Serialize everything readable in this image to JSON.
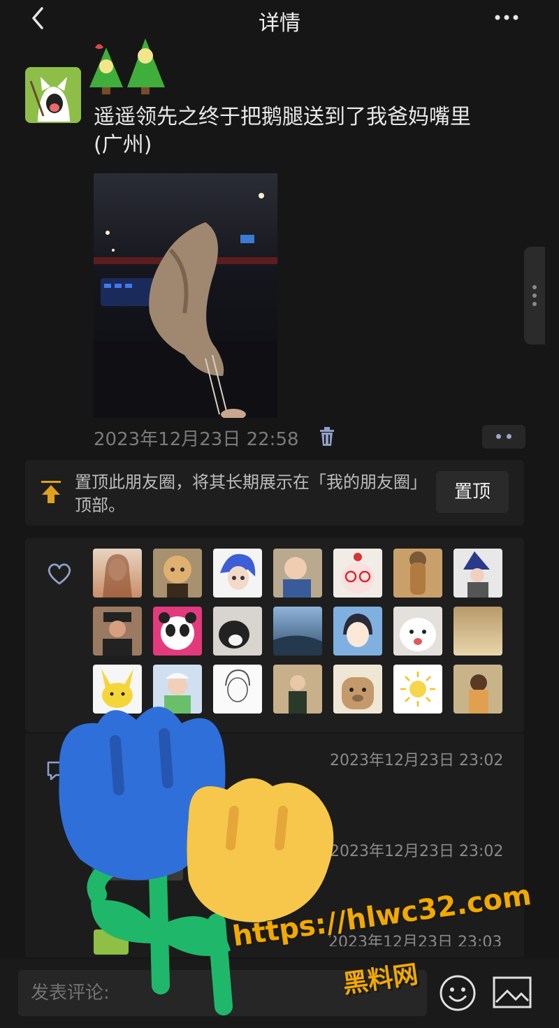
{
  "header": {
    "title": "详情"
  },
  "post": {
    "text": "遥遥领先之终于把鹅腿送到了我爸妈嘴里",
    "location": "(广州)",
    "time": "2023年12月23日 22:58"
  },
  "pin": {
    "description": "置顶此朋友圈，将其长期展示在「我的朋友圈」顶部。",
    "button_label": "置顶"
  },
  "likes": {
    "avatar_icons": [
      "woman-portrait",
      "cartoon-girl",
      "blue-anime-boy",
      "baby-photo",
      "cake-cartoon",
      "guitar-cat",
      "woman-hat",
      "man-hat",
      "panda-cartoon",
      "cat-photo",
      "seascape",
      "anime-girl",
      "white-dog",
      "gold-silk",
      "pikachu",
      "woman-flowers",
      "sketch-boy",
      "woman-portrait-2",
      "capybara",
      "sun-drawing",
      "illustration"
    ]
  },
  "comments": [
    {
      "time": "2023年12月23日 23:02"
    },
    {
      "time": "2023年12月23日 23:02"
    },
    {
      "time": "2023年12月23日 23:03"
    }
  ],
  "compose": {
    "placeholder": "发表评论:"
  },
  "watermark": {
    "url": "https://hlwc32.com",
    "name": "黑料网"
  },
  "colors": {
    "background": "#161616",
    "panel": "#1e1e1e",
    "watermark": "#f2a900",
    "tulip_blue": "#2f6fd9",
    "tulip_yellow": "#f6c74a",
    "stem": "#1fb86b"
  }
}
